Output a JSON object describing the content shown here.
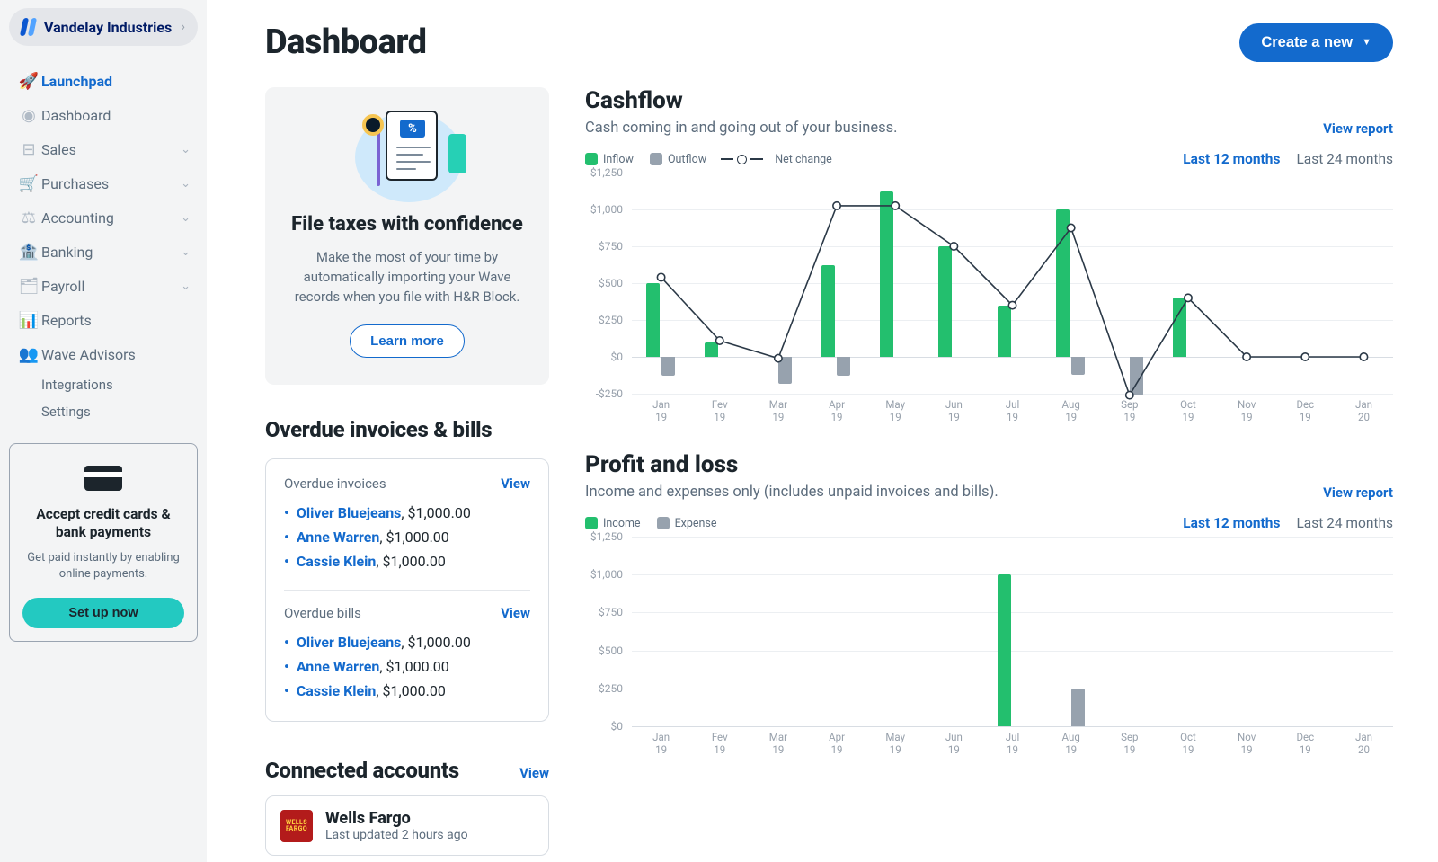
{
  "business": {
    "name": "Vandelay Industries"
  },
  "sidebar": {
    "items": [
      {
        "label": "Launchpad",
        "icon": "🚀",
        "active": true
      },
      {
        "label": "Dashboard",
        "icon": "◉"
      },
      {
        "label": "Sales",
        "icon": "⊟",
        "expandable": true
      },
      {
        "label": "Purchases",
        "icon": "🛒",
        "expandable": true
      },
      {
        "label": "Accounting",
        "icon": "⚖",
        "expandable": true
      },
      {
        "label": "Banking",
        "icon": "🏦",
        "expandable": true
      },
      {
        "label": "Payroll",
        "icon": "🗂",
        "expandable": true
      },
      {
        "label": "Reports",
        "icon": "📊"
      },
      {
        "label": "Wave Advisors",
        "icon": "👥"
      }
    ],
    "sub": [
      "Integrations",
      "Settings"
    ]
  },
  "promo_sidebar": {
    "title": "Accept credit cards & bank payments",
    "body": "Get paid instantly by enabling online payments.",
    "cta": "Set up now"
  },
  "header": {
    "title": "Dashboard",
    "create_btn": "Create a new"
  },
  "tax_card": {
    "title": "File taxes with confidence",
    "body": "Make the most of your time by automatically importing your Wave records when you file with H&R Block.",
    "cta": "Learn more"
  },
  "overdue": {
    "heading": "Overdue invoices & bills",
    "invoices_title": "Overdue invoices",
    "bills_title": "Overdue bills",
    "view": "View",
    "invoices": [
      {
        "name": "Oliver Bluejeans",
        "amount": "$1,000.00"
      },
      {
        "name": "Anne Warren",
        "amount": "$1,000.00"
      },
      {
        "name": "Cassie Klein",
        "amount": "$1,000.00"
      }
    ],
    "bills": [
      {
        "name": "Oliver Bluejeans",
        "amount": "$1,000.00"
      },
      {
        "name": "Anne Warren",
        "amount": "$1,000.00"
      },
      {
        "name": "Cassie Klein",
        "amount": "$1,000.00"
      }
    ]
  },
  "connected": {
    "heading": "Connected accounts",
    "view": "View",
    "bank": "Wells Fargo",
    "bank_logo_l1": "WELLS",
    "bank_logo_l2": "FARGO",
    "updated": "Last updated 2 hours ago"
  },
  "cashflow": {
    "title": "Cashflow",
    "subtitle": "Cash coming in and going out of your business.",
    "view_report": "View report",
    "legend": {
      "inflow": "Inflow",
      "outflow": "Outflow",
      "net": "Net change"
    },
    "tabs": {
      "t12": "Last 12 months",
      "t24": "Last 24 months"
    }
  },
  "profitloss": {
    "title": "Profit and loss",
    "subtitle": "Income and expenses only (includes unpaid invoices and bills).",
    "view_report": "View report",
    "legend": {
      "income": "Income",
      "expense": "Expense"
    },
    "tabs": {
      "t12": "Last 12 months",
      "t24": "Last 24 months"
    }
  },
  "chart_data": [
    {
      "id": "cashflow",
      "type": "bar+line",
      "categories": [
        "Jan 19",
        "Fev 19",
        "Mar 19",
        "Apr 19",
        "May 19",
        "Jun 19",
        "Jul 19",
        "Aug 19",
        "Sep 19",
        "Oct 19",
        "Nov 19",
        "Dec 19",
        "Jan 20"
      ],
      "series": [
        {
          "name": "Inflow",
          "type": "bar",
          "values": [
            500,
            100,
            0,
            625,
            1125,
            750,
            350,
            1000,
            0,
            400,
            0,
            0,
            0,
            0
          ]
        },
        {
          "name": "Outflow",
          "type": "bar",
          "values": [
            -130,
            0,
            -180,
            -130,
            0,
            0,
            0,
            -120,
            -260,
            0,
            0,
            0,
            0,
            0
          ]
        },
        {
          "name": "Net change",
          "type": "line",
          "values": [
            540,
            110,
            -10,
            1025,
            1025,
            750,
            350,
            875,
            -260,
            400,
            0,
            0,
            0,
            0
          ]
        }
      ],
      "ylim": [
        -250,
        1250
      ],
      "yticks": [
        "-$250",
        "$0",
        "$250",
        "$500",
        "$750",
        "$1,000",
        "$1,250"
      ]
    },
    {
      "id": "profitloss",
      "type": "bar",
      "categories": [
        "Jan 19",
        "Fev 19",
        "Mar 19",
        "Apr 19",
        "May 19",
        "Jun 19",
        "Jul 19",
        "Aug 19",
        "Sep 19",
        "Oct 19",
        "Nov 19",
        "Dec 19",
        "Jan 20"
      ],
      "series": [
        {
          "name": "Income",
          "values": [
            0,
            0,
            0,
            0,
            0,
            0,
            1000,
            0,
            0,
            0,
            0,
            0,
            0
          ]
        },
        {
          "name": "Expense",
          "values": [
            0,
            0,
            0,
            0,
            0,
            0,
            0,
            250,
            0,
            0,
            0,
            0,
            0
          ]
        }
      ],
      "ylim": [
        0,
        1250
      ],
      "yticks": [
        "$0",
        "$250",
        "$500",
        "$750",
        "$1,000",
        "$1,250"
      ]
    }
  ]
}
